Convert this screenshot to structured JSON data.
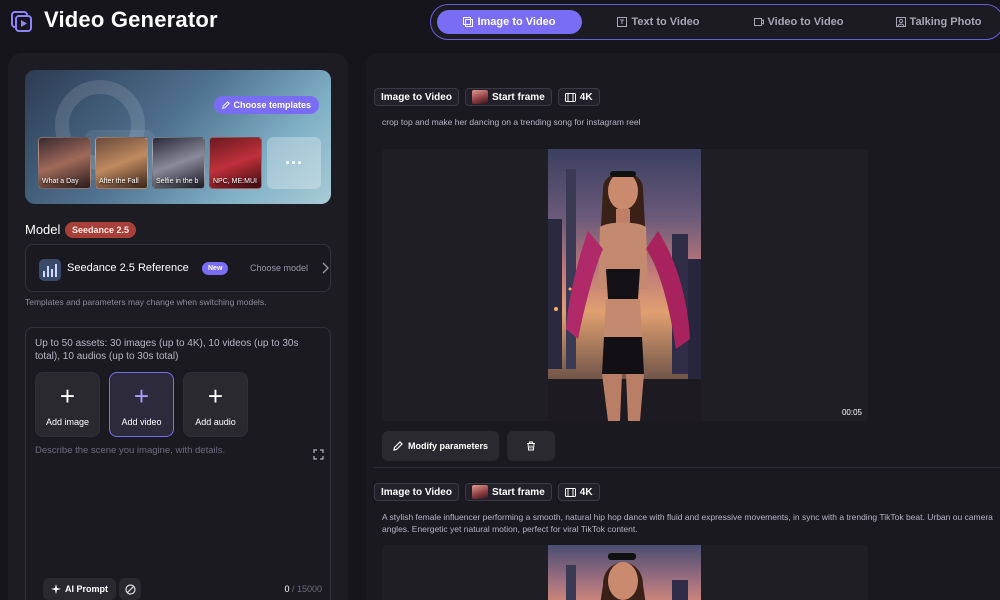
{
  "header": {
    "title": "Video Generator",
    "tabs": [
      {
        "label": "Image to Video",
        "active": true
      },
      {
        "label": "Text to Video",
        "active": false
      },
      {
        "label": "Video to Video",
        "active": false
      },
      {
        "label": "Talking Photo",
        "active": false
      }
    ]
  },
  "templates": {
    "button_label": "Choose templates",
    "items": [
      "What a Day",
      "After the Fall",
      "Selfie in the b",
      "NPC, ME:MUI"
    ],
    "more_label": "···"
  },
  "model": {
    "label": "Model",
    "badge": "Seedance 2.5",
    "name": "Seedance 2.5 Reference",
    "new_badge": "New",
    "choose_label": "Choose model",
    "hint": "Templates and parameters may change when switching models."
  },
  "assets": {
    "info": "Up to 50 assets: 30 images (up to 4K), 10 videos (up to 30s total), 10 audios (up to 30s total)",
    "add_image": "Add image",
    "add_video": "Add video",
    "add_audio": "Add audio",
    "prompt_placeholder": "Describe the scene you imagine, with details.",
    "ai_prompt_label": "AI Prompt",
    "char_count": "0",
    "char_max": "/ 15000"
  },
  "feed": [
    {
      "mode": "Image to Video",
      "start_frame": "Start frame",
      "resolution": "4K",
      "prompt": "crop top and make her dancing on a trending song for instagram reel",
      "duration": "00:05",
      "modify_label": "Modify parameters"
    },
    {
      "mode": "Image to Video",
      "start_frame": "Start frame",
      "resolution": "4K",
      "prompt": "A stylish female influencer performing a smooth, natural hip hop dance with fluid and expressive movements, in sync with a trending TikTok beat. Urban ou camera angles. Energetic yet natural motion, perfect for viral TikTok content."
    }
  ],
  "colors": {
    "accent": "#7a6df5",
    "badge_red": "#a8403a",
    "background": "#16151b"
  }
}
